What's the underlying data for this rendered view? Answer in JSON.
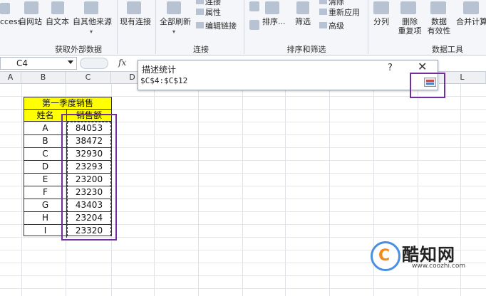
{
  "ribbon": {
    "groups": {
      "external_data": "获取外部数据",
      "connections": "连接",
      "sort_filter": "排序和筛选",
      "data_tools": "数据工具"
    },
    "buttons": {
      "access": "ccess",
      "from_web": "自网站",
      "from_text": "自文本",
      "from_other": "自其他来源",
      "existing": "现有连接",
      "refresh_all": "全部刷新",
      "connections": "连接",
      "properties": "属性",
      "edit_links": "编辑链接",
      "sort": "排序...",
      "filter": "筛选",
      "clear": "清除",
      "reapply": "重新应用",
      "advanced": "高级",
      "text_to_columns": "分列",
      "remove_dup_line1": "删除",
      "remove_dup_line2": "重复项",
      "validation_line1": "数据",
      "validation_line2": "有效性",
      "consolidate": "合并计算"
    }
  },
  "formula_bar": {
    "name_box": "C4",
    "fx": "fx"
  },
  "columns": [
    "A",
    "B",
    "C",
    "D",
    "L"
  ],
  "table": {
    "title": "第一季度销售",
    "header_name": "姓名",
    "header_sales": "销售额",
    "rows": [
      {
        "name": "A",
        "value": "84053"
      },
      {
        "name": "B",
        "value": "38472"
      },
      {
        "name": "C",
        "value": "32930"
      },
      {
        "name": "D",
        "value": "23293"
      },
      {
        "name": "E",
        "value": "23200"
      },
      {
        "name": "F",
        "value": "23230"
      },
      {
        "name": "G",
        "value": "43403"
      },
      {
        "name": "H",
        "value": "23204"
      },
      {
        "name": "I",
        "value": "23320"
      }
    ]
  },
  "dialog": {
    "title": "描述统计",
    "help": "?",
    "close": "✕",
    "input_value": "$C$4:$C$12"
  },
  "watermark": {
    "name": "酷知网",
    "url": "www.coozhi.com"
  },
  "colors": {
    "highlight": "#7030a0",
    "header_fill": "#ffff00"
  }
}
